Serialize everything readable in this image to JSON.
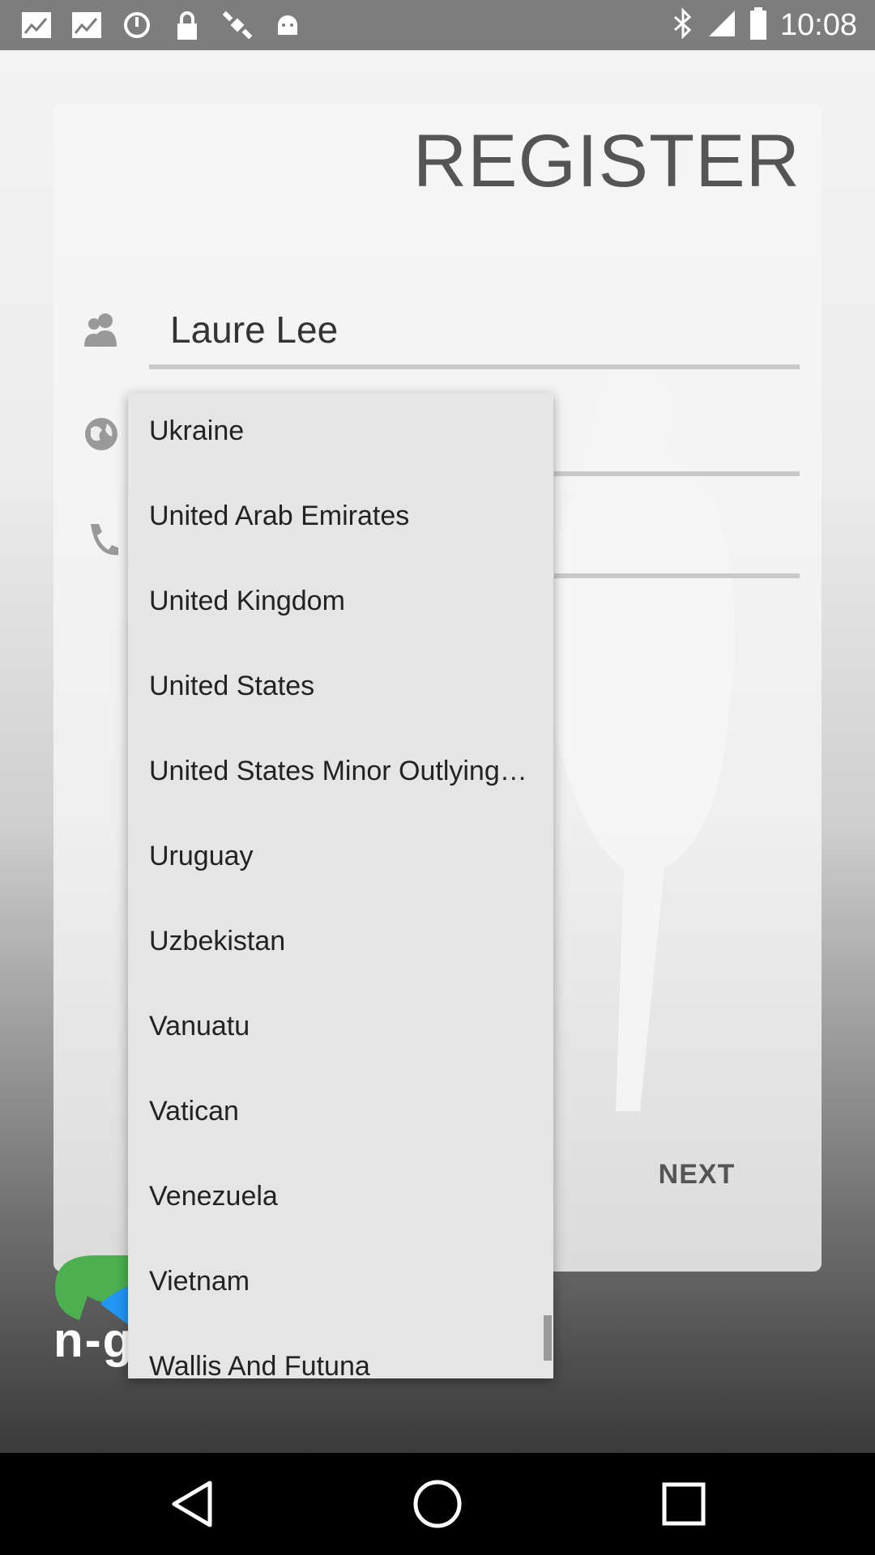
{
  "status_bar": {
    "time": "10:08",
    "left_icons": [
      "iifl-markets-icon",
      "iifl-markets-icon",
      "sync-icon",
      "lock-icon",
      "satellite-icon",
      "android-icon"
    ],
    "right_icons": [
      "bluetooth-icon",
      "signal-icon",
      "battery-icon"
    ]
  },
  "register": {
    "title": "REGISTER",
    "name_value": "Laure Lee",
    "next_label": "NEXT"
  },
  "logo": {
    "text": "n-g"
  },
  "dropdown": {
    "items": [
      "Ukraine",
      "United Arab Emirates",
      "United Kingdom",
      "United States",
      "United States Minor Outlying…",
      "Uruguay",
      "Uzbekistan",
      "Vanuatu",
      "Vatican",
      "Venezuela",
      "Vietnam",
      "Wallis And Futuna"
    ]
  },
  "nav": {
    "back": "back-icon",
    "home": "home-icon",
    "recents": "recents-icon"
  },
  "colors": {
    "status_bar": "#7d7d7d",
    "dropdown_bg": "#e5e5e5",
    "logo_green": "#4caf50",
    "logo_blue": "#2196f3"
  }
}
